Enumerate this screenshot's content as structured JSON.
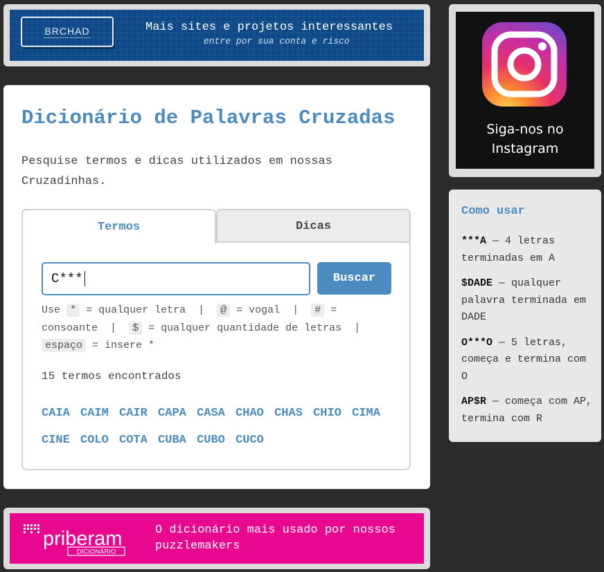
{
  "top_banner": {
    "logo": "BRCHAD",
    "title": "Mais sites e projetos interessantes",
    "subtitle": "entre por sua conta e risco"
  },
  "main": {
    "title": "Dicionário de Palavras Cruzadas",
    "description": "Pesquise termos e dicas utilizados em nossas Cruzadinhas.",
    "tabs": [
      {
        "label": "Termos",
        "active": true
      },
      {
        "label": "Dicas",
        "active": false
      }
    ],
    "search": {
      "value": "C***",
      "button": "Buscar"
    },
    "help": {
      "use": "Use",
      "star": "*",
      "star_desc": "= qualquer letra",
      "sep": "|",
      "at": "@",
      "at_desc": "= vogal",
      "hash": "#",
      "hash_desc": "= consoante",
      "dollar": "$",
      "dollar_desc": "= qualquer quantidade de letras",
      "space": "espaço",
      "space_desc": "= insere *"
    },
    "count": "15 termos encontrados",
    "results": [
      "CAIA",
      "CAIM",
      "CAIR",
      "CAPA",
      "CASA",
      "CHAO",
      "CHAS",
      "CHIO",
      "CIMA",
      "CINE",
      "COLO",
      "COTA",
      "CUBA",
      "CUBO",
      "CUCO"
    ]
  },
  "bottom_banner": {
    "logo": "priberam",
    "logo_sub": "DICIONÁRIO",
    "text": "O dicionário mais usado por nossos puzzlemakers"
  },
  "instagram": {
    "caption_line1": "Siga-nos no",
    "caption_line2": "Instagram"
  },
  "como_usar": {
    "title": "Como usar",
    "items": [
      {
        "pattern": "***A",
        "desc": "— 4 letras terminadas em A"
      },
      {
        "pattern": "$DADE",
        "desc": "— qualquer palavra terminada em DADE"
      },
      {
        "pattern": "O***O",
        "desc": "— 5 letras, começa e termina com O"
      },
      {
        "pattern": "AP$R",
        "desc": "— começa com AP, termina com R"
      }
    ]
  },
  "colors": {
    "accent": "#4b8bbf",
    "background": "#2b2b2b",
    "priberam": "#e8078f",
    "brchad": "#0e4a88"
  }
}
